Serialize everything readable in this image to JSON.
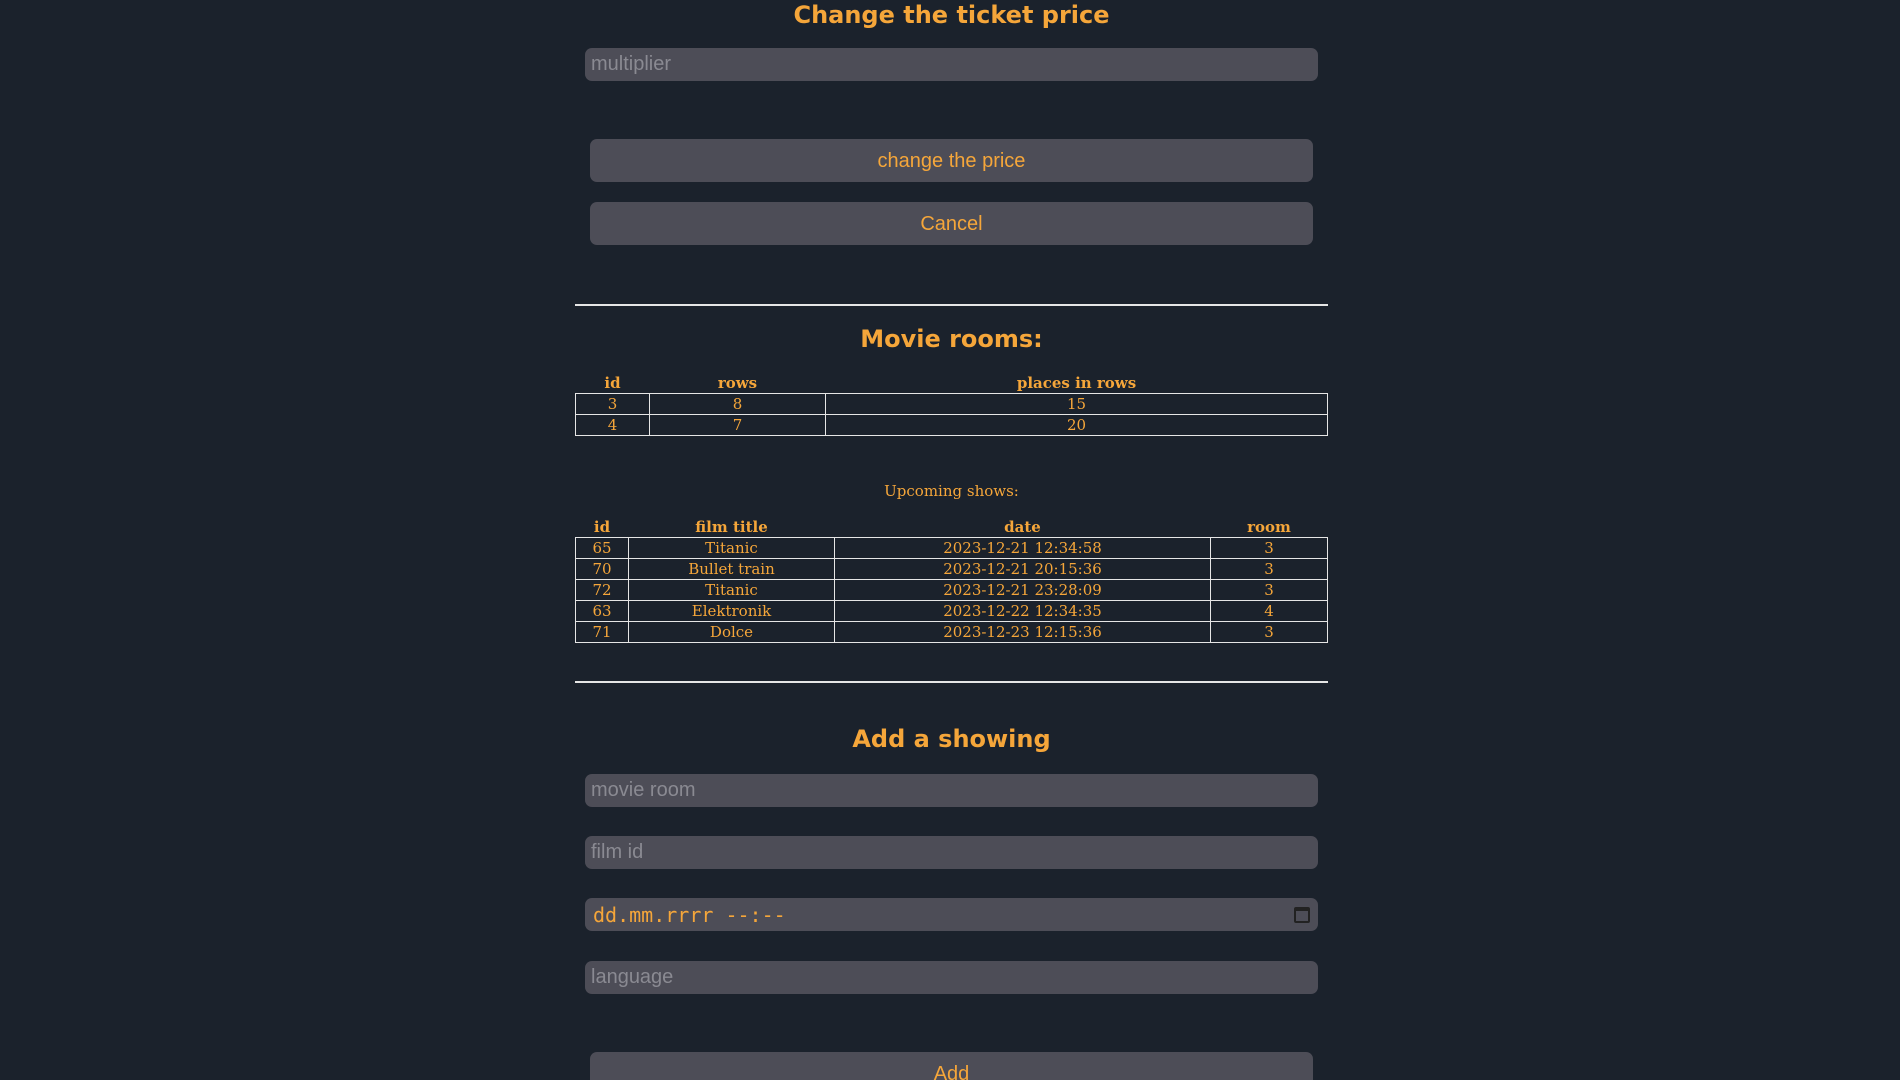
{
  "price_form": {
    "title": "Change the ticket price",
    "multiplier_placeholder": "multiplier",
    "submit_label": "change the price",
    "cancel_label": "Cancel"
  },
  "rooms": {
    "title": "Movie rooms:",
    "headers": [
      "id",
      "rows",
      "places in rows"
    ],
    "rows": [
      [
        "3",
        "8",
        "15"
      ],
      [
        "4",
        "7",
        "20"
      ]
    ]
  },
  "shows": {
    "caption": "Upcoming shows:",
    "headers": [
      "id",
      "film title",
      "date",
      "room"
    ],
    "rows": [
      [
        "65",
        "Titanic",
        "2023-12-21 12:34:58",
        "3"
      ],
      [
        "70",
        "Bullet train",
        "2023-12-21 20:15:36",
        "3"
      ],
      [
        "72",
        "Titanic",
        "2023-12-21 23:28:09",
        "3"
      ],
      [
        "63",
        "Elektronik",
        "2023-12-22 12:34:35",
        "4"
      ],
      [
        "71",
        "Dolce",
        "2023-12-23 12:15:36",
        "3"
      ]
    ]
  },
  "add_form": {
    "title": "Add a showing",
    "room_placeholder": "movie room",
    "film_placeholder": "film id",
    "date_placeholder": "dd.mm.rrrr --:--",
    "language_placeholder": "language",
    "submit_label": "Add"
  },
  "colors": {
    "background": "#1b222c",
    "accent": "#f5a63a",
    "field": "#4d4d57"
  },
  "icons": {
    "date_picker": "calendar-icon"
  }
}
